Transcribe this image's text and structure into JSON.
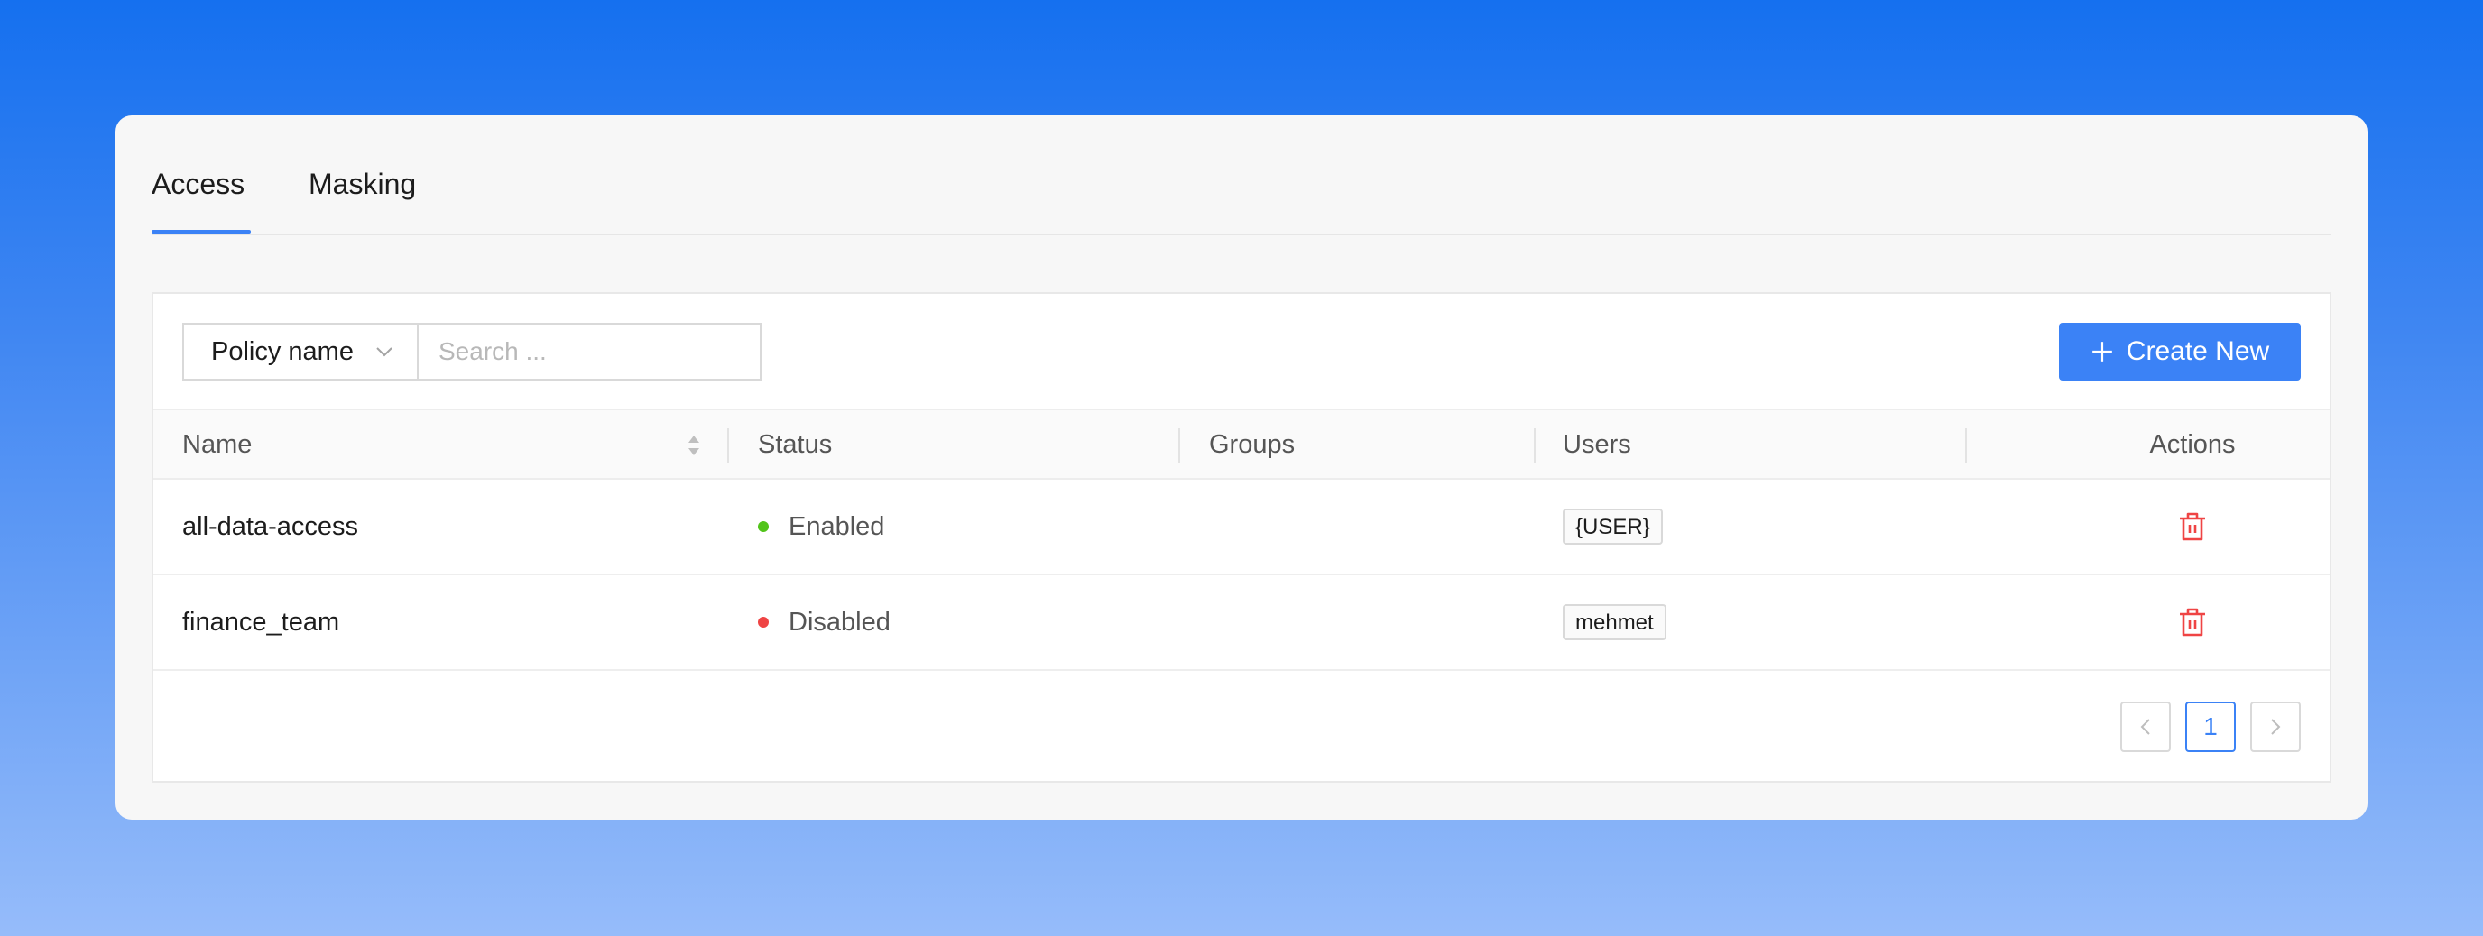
{
  "tabs": [
    {
      "label": "Access",
      "active": true
    },
    {
      "label": "Masking",
      "active": false
    }
  ],
  "toolbar": {
    "filter_field": "Policy name",
    "search_placeholder": "Search ...",
    "search_value": "",
    "create_label": "Create New"
  },
  "table": {
    "columns": [
      "Name",
      "Status",
      "Groups",
      "Users",
      "Actions"
    ],
    "rows": [
      {
        "name": "all-data-access",
        "status": "Enabled",
        "status_color": "#52c41a",
        "groups": "",
        "users": "{USER}"
      },
      {
        "name": "finance_team",
        "status": "Disabled",
        "status_color": "#ef4444",
        "groups": "",
        "users": "mehmet"
      }
    ]
  },
  "pagination": {
    "current_page": "1"
  },
  "colors": {
    "accent": "#3b82f6",
    "danger": "#ef4444",
    "enabled": "#52c41a"
  },
  "icons": {
    "filter_chevron": "chevron-down-icon",
    "create": "plus-icon",
    "sort": "sort-icon",
    "delete": "trash-icon",
    "prev": "chevron-left-icon",
    "next": "chevron-right-icon"
  }
}
